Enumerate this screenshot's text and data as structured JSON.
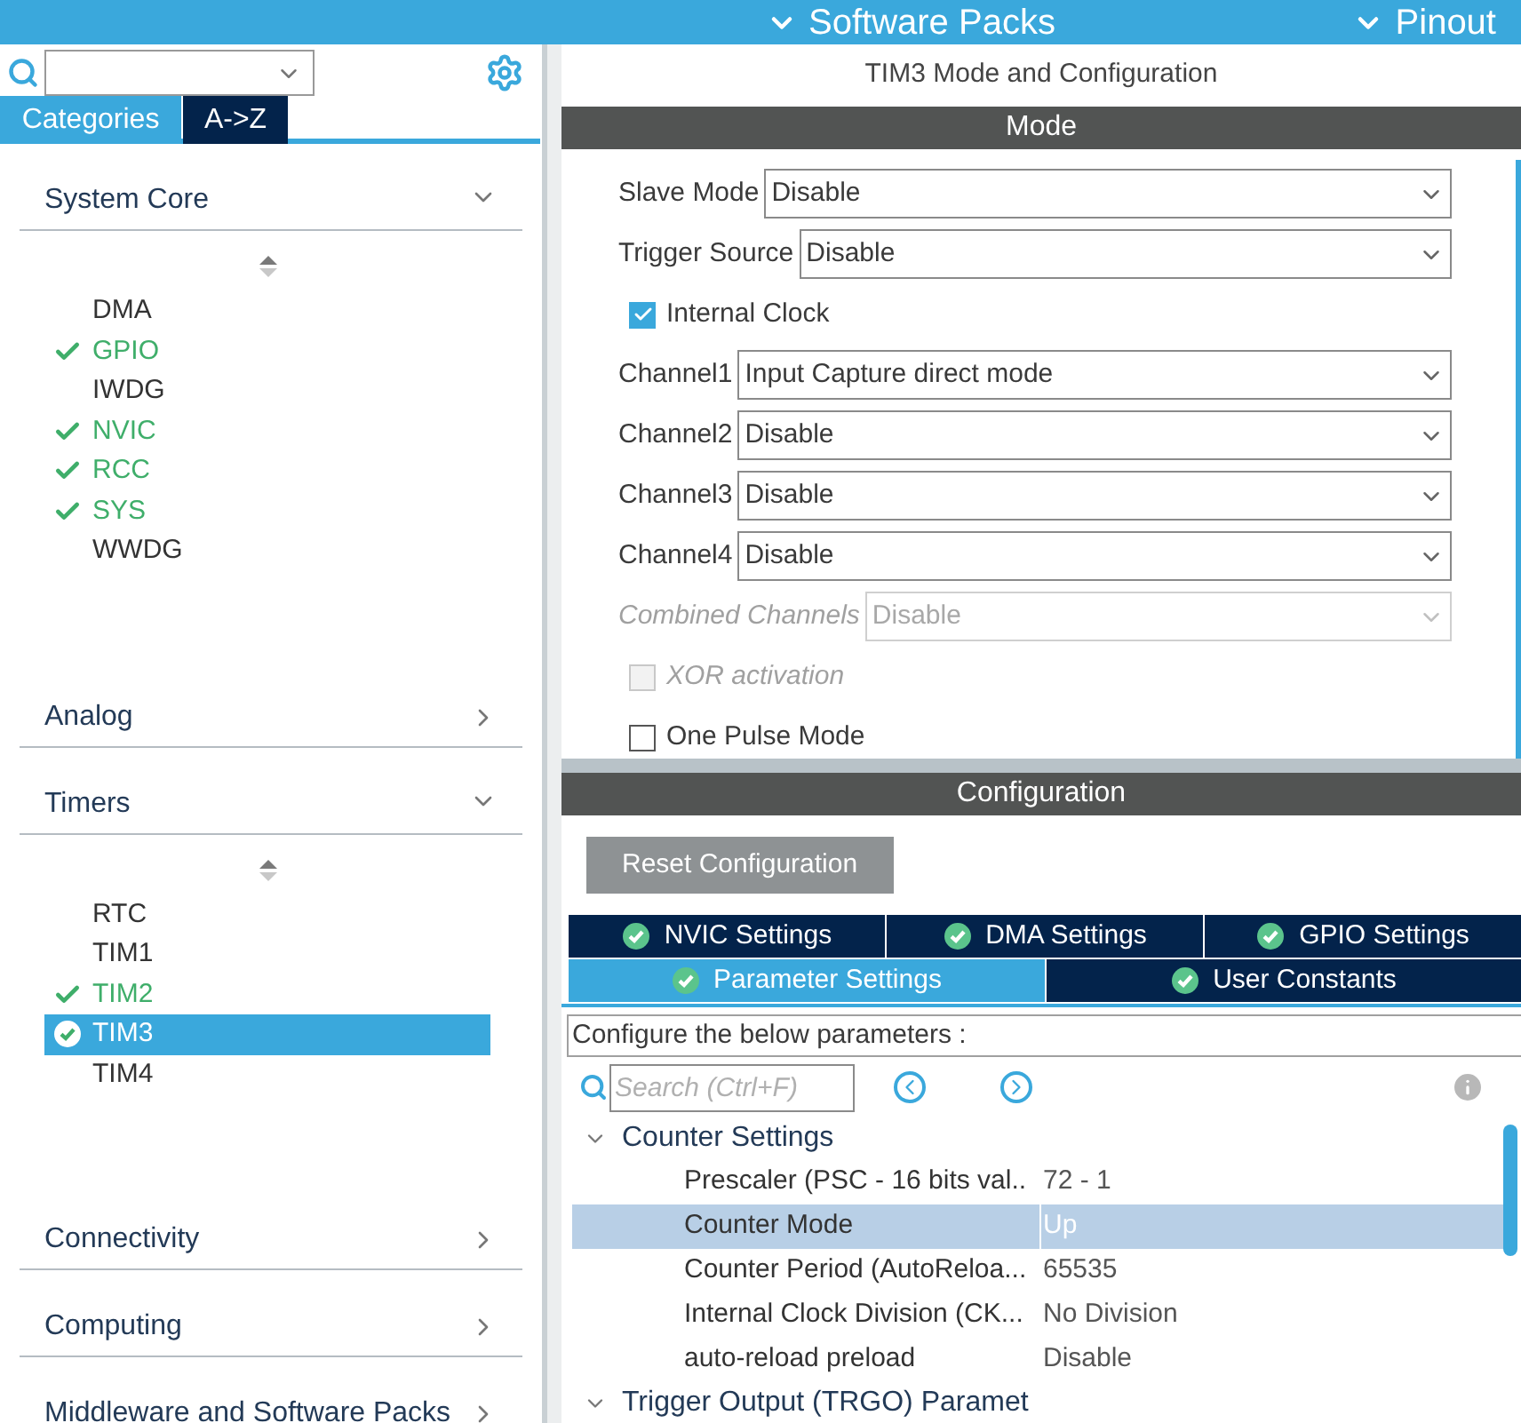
{
  "top_bar": {
    "menus": [
      {
        "label": "Software Packs"
      },
      {
        "label": "Pinout"
      }
    ]
  },
  "sidebar": {
    "tabs": [
      {
        "label": "Categories",
        "selected": true
      },
      {
        "label": "A->Z",
        "selected": false
      }
    ],
    "categories": [
      {
        "label": "System Core",
        "expanded": true,
        "items": [
          {
            "label": "DMA",
            "checked": false,
            "selected": false
          },
          {
            "label": "GPIO",
            "checked": true,
            "selected": false
          },
          {
            "label": "IWDG",
            "checked": false,
            "selected": false
          },
          {
            "label": "NVIC",
            "checked": true,
            "selected": false
          },
          {
            "label": "RCC",
            "checked": true,
            "selected": false
          },
          {
            "label": "SYS",
            "checked": true,
            "selected": false
          },
          {
            "label": "WWDG",
            "checked": false,
            "selected": false
          }
        ]
      },
      {
        "label": "Analog",
        "expanded": false
      },
      {
        "label": "Timers",
        "expanded": true,
        "items": [
          {
            "label": "RTC",
            "checked": false,
            "selected": false
          },
          {
            "label": "TIM1",
            "checked": false,
            "selected": false
          },
          {
            "label": "TIM2",
            "checked": true,
            "selected": false
          },
          {
            "label": "TIM3",
            "checked": true,
            "selected": true
          },
          {
            "label": "TIM4",
            "checked": false,
            "selected": false
          }
        ]
      },
      {
        "label": "Connectivity",
        "expanded": false
      },
      {
        "label": "Computing",
        "expanded": false
      },
      {
        "label": "Middleware and Software Packs",
        "expanded": false
      }
    ]
  },
  "main": {
    "title": "TIM3 Mode and Configuration",
    "mode": {
      "header": "Mode",
      "fields": [
        {
          "kind": "select",
          "label": "Slave Mode",
          "value": "Disable",
          "disabled": false
        },
        {
          "kind": "select",
          "label": "Trigger Source",
          "value": "Disable",
          "disabled": false
        },
        {
          "kind": "checkbox",
          "label": "Internal Clock",
          "checked": true,
          "disabled": false
        },
        {
          "kind": "select",
          "label": "Channel1",
          "value": "Input Capture direct mode",
          "disabled": false
        },
        {
          "kind": "select",
          "label": "Channel2",
          "value": "Disable",
          "disabled": false
        },
        {
          "kind": "select",
          "label": "Channel3",
          "value": "Disable",
          "disabled": false
        },
        {
          "kind": "select",
          "label": "Channel4",
          "value": "Disable",
          "disabled": false
        },
        {
          "kind": "select",
          "label": "Combined Channels",
          "value": "Disable",
          "disabled": true
        },
        {
          "kind": "checkbox",
          "label": "XOR activation",
          "checked": false,
          "disabled": true
        },
        {
          "kind": "checkbox",
          "label": "One Pulse Mode",
          "checked": false,
          "disabled": false
        }
      ]
    },
    "configuration": {
      "header": "Configuration",
      "reset_button": "Reset Configuration",
      "tab_rows": [
        [
          {
            "label": "NVIC Settings",
            "selected": false
          },
          {
            "label": "DMA Settings",
            "selected": false
          },
          {
            "label": "GPIO Settings",
            "selected": false
          }
        ],
        [
          {
            "label": "Parameter Settings",
            "selected": true
          },
          {
            "label": "User Constants",
            "selected": false
          }
        ]
      ],
      "hint": "Configure the below parameters :",
      "search": {
        "placeholder": "Search (Ctrl+F)"
      },
      "parameters": [
        {
          "label": "Counter Settings",
          "expanded": true,
          "children": [
            {
              "label": "Prescaler (PSC - 16 bits val..",
              "value": "72 - 1",
              "selected": false
            },
            {
              "label": "Counter Mode",
              "value": "Up",
              "selected": true
            },
            {
              "label": "Counter Period (AutoReloa...",
              "value": "65535",
              "selected": false
            },
            {
              "label": "Internal Clock Division (CK...",
              "value": "No Division",
              "selected": false
            },
            {
              "label": "auto-reload preload",
              "value": "Disable",
              "selected": false
            }
          ]
        },
        {
          "label": "Trigger Output (TRGO) Paramet",
          "expanded": true
        }
      ]
    }
  }
}
